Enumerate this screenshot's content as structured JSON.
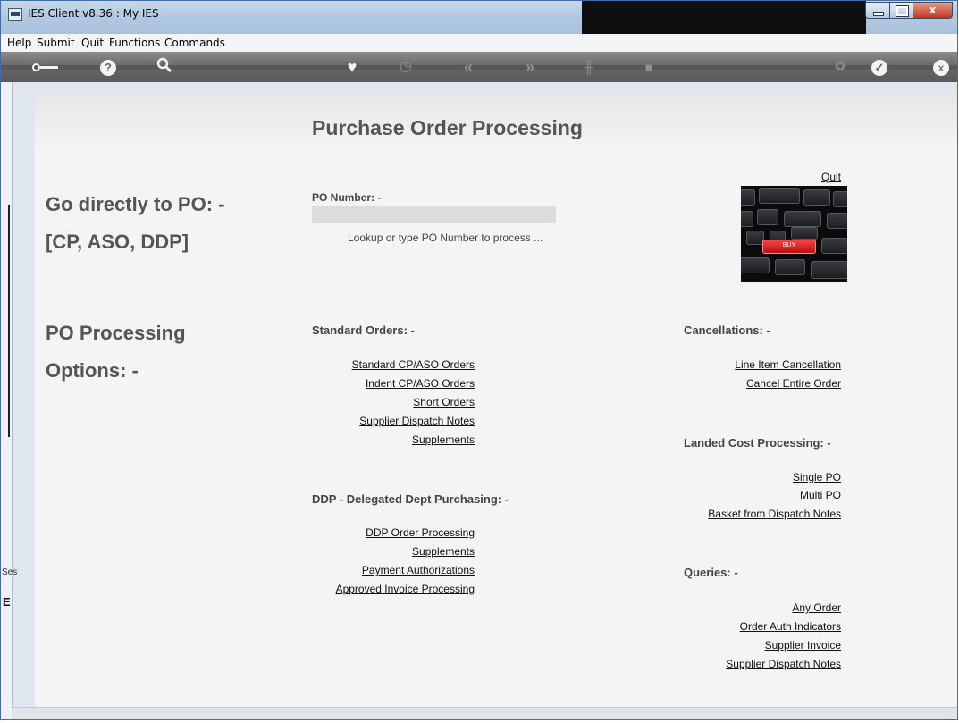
{
  "window": {
    "title": "IES Client v8.36 : My IES",
    "controls": {
      "minimize": "–",
      "maximize": "□",
      "close": "x"
    }
  },
  "menu": [
    "Help",
    "Submit",
    "Quit",
    "Functions",
    "Commands"
  ],
  "toolbar": {
    "icons": [
      "key-icon",
      "help-icon",
      "search-icon",
      "heart-icon",
      "clock-icon",
      "previous-icon",
      "next-icon",
      "tools-icon",
      "chip-icon",
      "recycle-icon",
      "check-icon",
      "close-icon"
    ]
  },
  "side": {
    "ses": "Ses",
    "e": "E"
  },
  "page": {
    "title": "Purchase Order Processing",
    "go_directly_line1": "Go directly to PO: -",
    "go_directly_line2": "[CP, ASO, DDP]",
    "options_line1": "PO Processing",
    "options_line2": "Options: -",
    "quit": "Quit",
    "po_number_label": "PO Number: -",
    "po_number_value": "",
    "hint": "Lookup or type PO Number to process ...",
    "keyboard_key": "BUY"
  },
  "standard_orders": {
    "label": "Standard Orders: -",
    "links": [
      "Standard CP/ASO Orders",
      "Indent CP/ASO Orders",
      "Short Orders",
      "Supplier Dispatch Notes",
      "Supplements"
    ]
  },
  "ddp": {
    "label": "DDP - Delegated Dept Purchasing: -",
    "links": [
      "DDP Order Processing",
      "Supplements",
      "Payment Authorizations",
      "Approved Invoice Processing"
    ]
  },
  "cancellations": {
    "label": "Cancellations: -",
    "links": [
      "Line Item Cancellation",
      "Cancel Entire Order"
    ]
  },
  "landed_cost": {
    "label": "Landed Cost Processing: -",
    "links": [
      "Single PO",
      "Multi PO",
      "Basket from Dispatch Notes"
    ]
  },
  "queries": {
    "label": "Queries: -",
    "links": [
      "Any Order",
      "Order Auth Indicators",
      "Supplier Invoice",
      "Supplier Dispatch Notes"
    ]
  }
}
